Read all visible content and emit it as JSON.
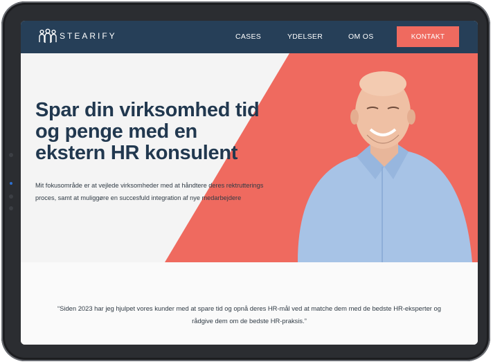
{
  "nav": {
    "logo_text": "STEARIFY",
    "links": [
      "CASES",
      "YDELSER",
      "OM OS"
    ],
    "cta_label": "KONTAKT"
  },
  "hero": {
    "headline": "Spar din virksomhed tid og penge med en ekstern HR konsulent",
    "subtext": "Mit fokusområde er at vejlede virksomheder med at håndtere deres rektrutterings proces, samt at muliggøre en succesfuld integration af nye medarbejdere"
  },
  "quote": {
    "text": "“Siden 2023 har jeg hjulpet vores kunder med at spare tid og opnå deres HR-mål ved at matche dem med de bedste HR-eksperter og rådgive dem om de bedste HR-praksis.”"
  },
  "colors": {
    "nav_bg": "#263f58",
    "accent": "#ef6a5f",
    "headline": "#21384f"
  },
  "icons": [
    "people-logo-icon"
  ]
}
